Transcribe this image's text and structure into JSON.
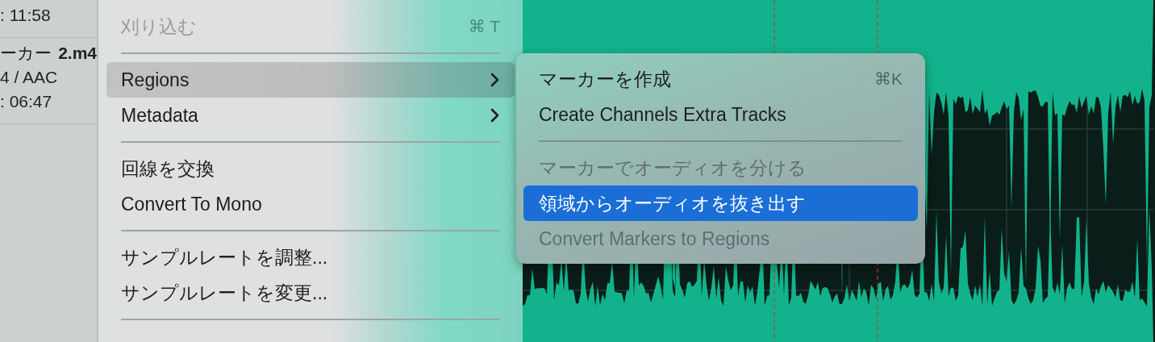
{
  "sidebar": {
    "items": [
      {
        "duration": ": 11:58"
      },
      {
        "label": "ーカー",
        "name": "2.m4",
        "format": "4 / AAC",
        "duration": ": 06:47"
      }
    ]
  },
  "menu": {
    "items": [
      {
        "kind": "item",
        "label": "刈り込む",
        "shortcut": "⌘ T",
        "disabled": true,
        "selected": false
      },
      {
        "kind": "separator"
      },
      {
        "kind": "item",
        "label": "Regions",
        "submenu": true,
        "disabled": false,
        "selected": true
      },
      {
        "kind": "item",
        "label": "Metadata",
        "submenu": true,
        "disabled": false,
        "selected": false
      },
      {
        "kind": "separator"
      },
      {
        "kind": "item",
        "label": "回線を交換",
        "disabled": false,
        "selected": false
      },
      {
        "kind": "item",
        "label": "Convert To Mono",
        "disabled": false,
        "selected": false
      },
      {
        "kind": "separator"
      },
      {
        "kind": "item",
        "label": "サンプルレートを調整...",
        "disabled": false,
        "selected": false
      },
      {
        "kind": "item",
        "label": "サンプルレートを変更...",
        "disabled": false,
        "selected": false
      },
      {
        "kind": "separator"
      }
    ]
  },
  "submenu": {
    "items": [
      {
        "kind": "item",
        "label": "マーカーを作成",
        "shortcut": "⌘K",
        "disabled": false,
        "selected": false
      },
      {
        "kind": "item",
        "label": "Create Channels Extra Tracks",
        "disabled": false,
        "selected": false
      },
      {
        "kind": "separator"
      },
      {
        "kind": "item",
        "label": "マーカーでオーディオを分ける",
        "disabled": true,
        "selected": false
      },
      {
        "kind": "item",
        "label": "領域からオーディオを抜き出す",
        "disabled": false,
        "selected": true
      },
      {
        "kind": "item",
        "label": "Convert Markers to Regions",
        "disabled": true,
        "selected": false
      }
    ]
  }
}
